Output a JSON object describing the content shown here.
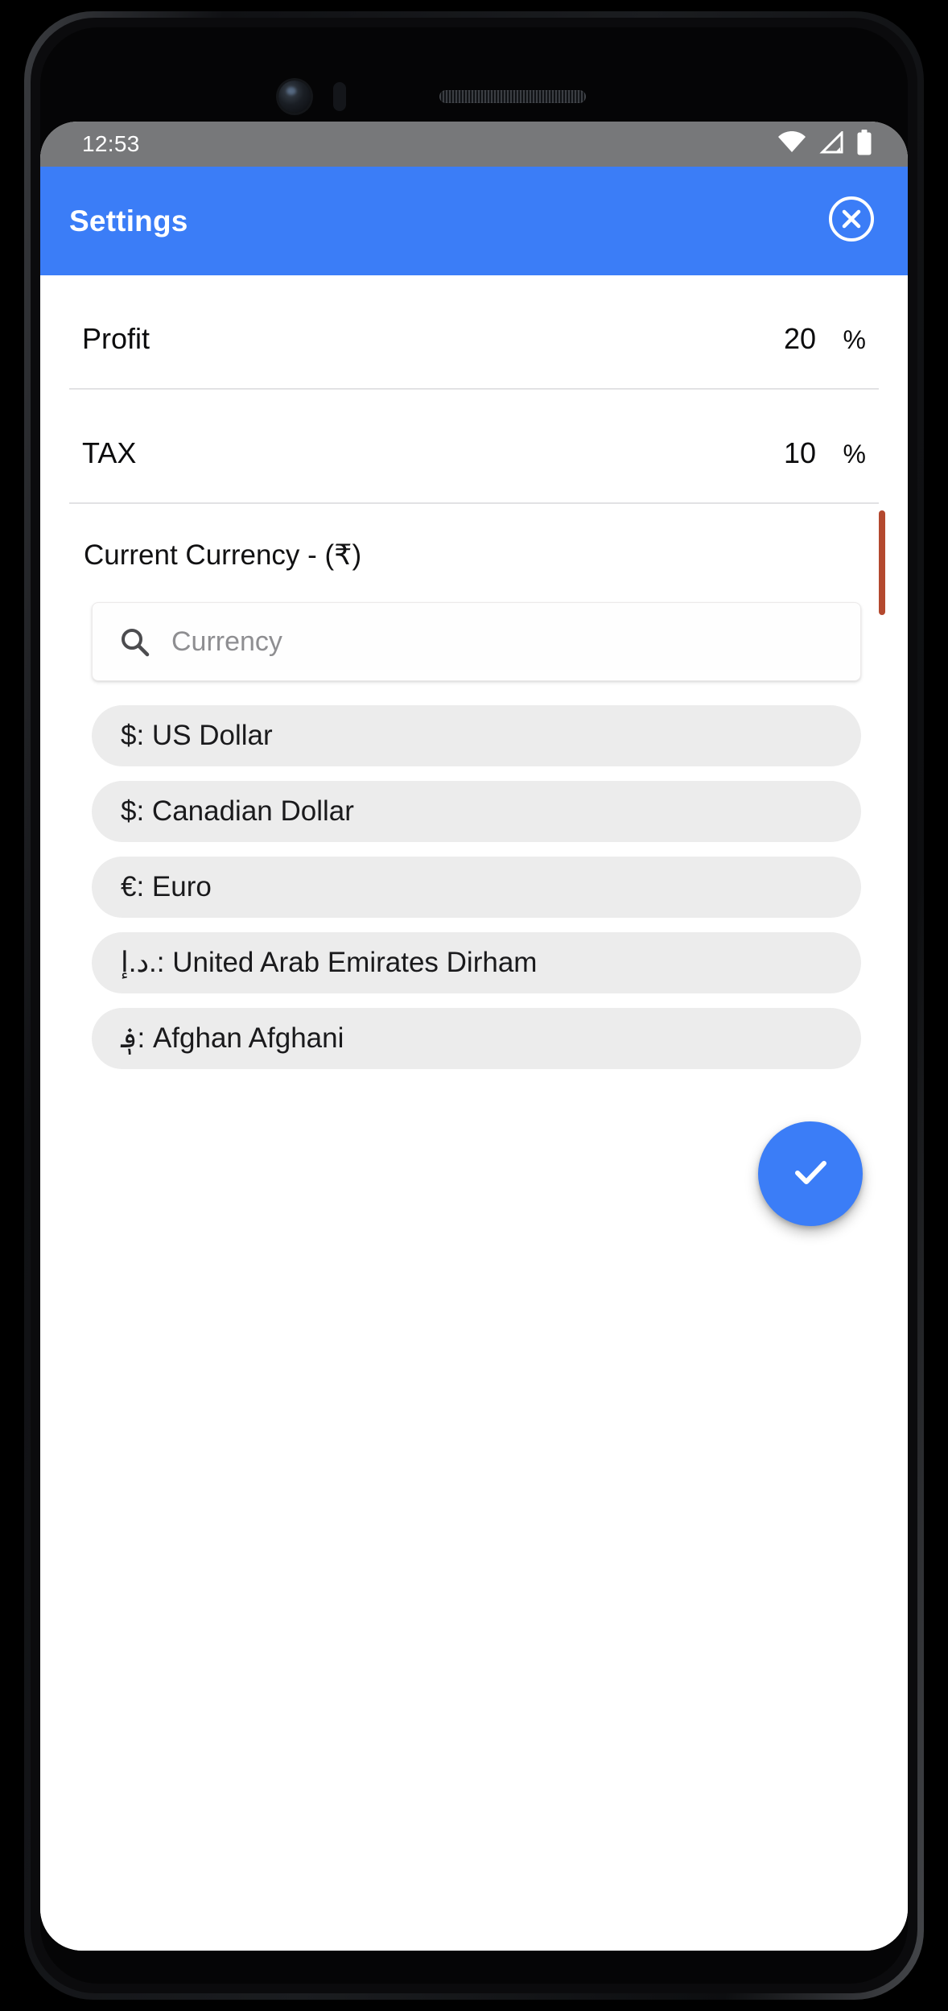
{
  "status_bar": {
    "time": "12:53",
    "icons": [
      "wifi-icon",
      "cellular-signal-icon",
      "battery-icon"
    ],
    "background": "#77787a"
  },
  "app_bar": {
    "title": "Settings",
    "close_label": "close-icon",
    "background": "#3b7df7"
  },
  "fields": [
    {
      "label": "Profit",
      "value": "20",
      "suffix": "%"
    },
    {
      "label": "TAX",
      "value": "10",
      "suffix": "%"
    }
  ],
  "currency_section": {
    "label": "Current Currency - (₹)",
    "current_symbol": "₹"
  },
  "search": {
    "placeholder": "Currency",
    "value": "",
    "icon": "search-icon"
  },
  "currency_list": [
    {
      "text": "$: US Dollar"
    },
    {
      "text": "$: Canadian Dollar"
    },
    {
      "text": "€: Euro"
    },
    {
      "text": "د.إ.: United Arab Emirates Dirham"
    },
    {
      "text": "؋: Afghan Afghani"
    }
  ],
  "fab": {
    "name": "confirm-button",
    "icon": "check-icon",
    "color": "#3b7df7"
  }
}
